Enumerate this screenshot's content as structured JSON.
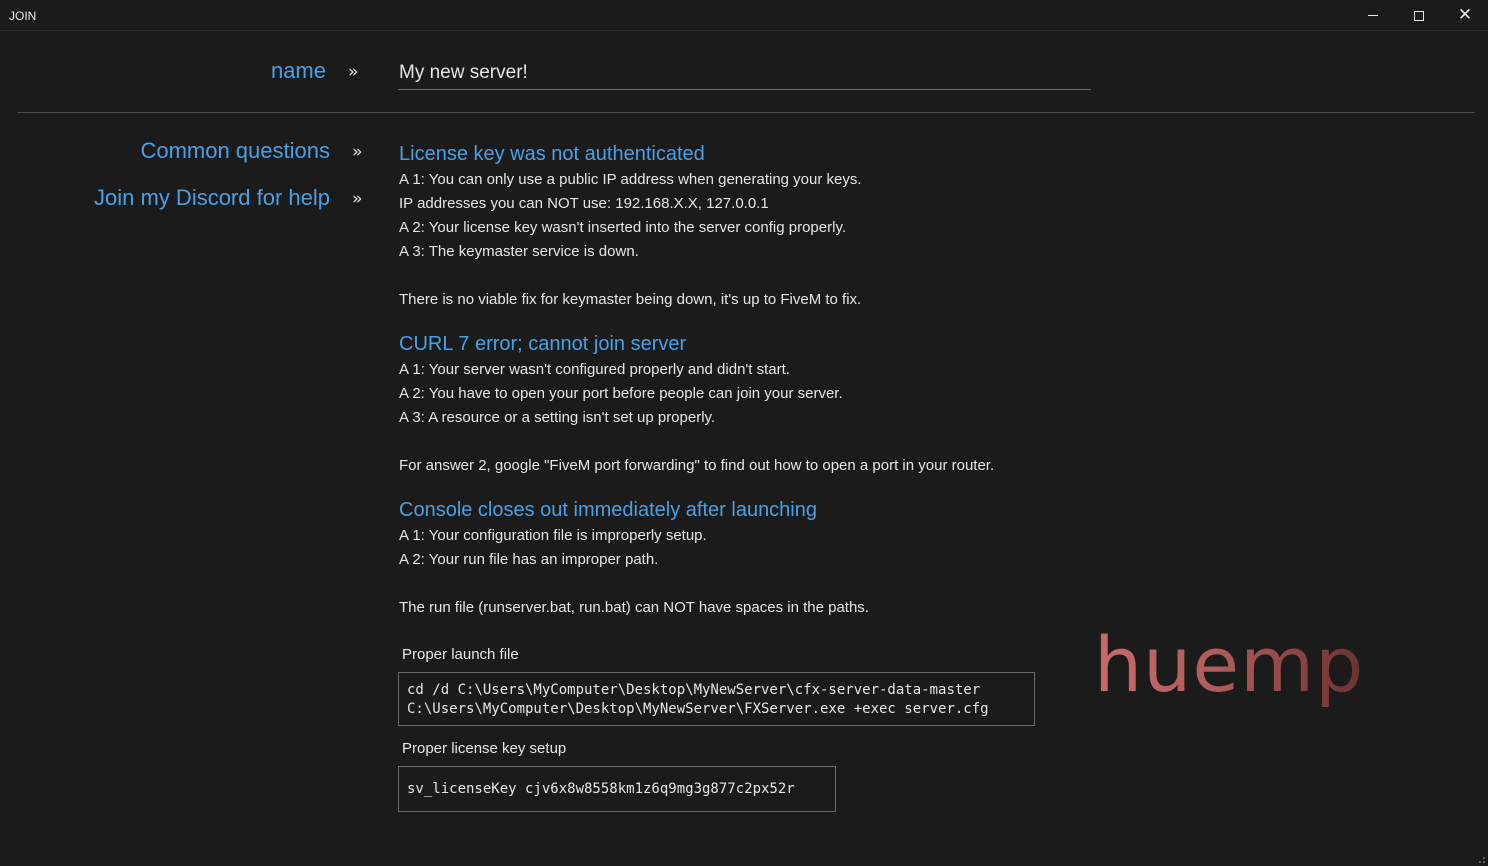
{
  "window": {
    "title": "JOIN",
    "minimize_glyph": "minimize-icon",
    "maximize_glyph": "maximize-icon",
    "close_glyph": "✕"
  },
  "name_row": {
    "label": "name",
    "chevron": "››",
    "value": "My new server!"
  },
  "nav": {
    "items": [
      {
        "label": "Common questions",
        "chevron": "››"
      },
      {
        "label": "Join my Discord for help",
        "chevron": "››"
      }
    ]
  },
  "faq": [
    {
      "title": "License key was not authenticated",
      "lines": [
        "A 1: You can only use a public IP address when generating your keys.",
        "IP addresses you can NOT use: 192.168.X.X, 127.0.0.1",
        "A 2: Your license key wasn't inserted into the server config properly.",
        "A 3: The keymaster service is down."
      ],
      "note": "There is no viable fix for keymaster being down, it's up to FiveM to fix."
    },
    {
      "title": "CURL 7 error; cannot join server",
      "lines": [
        "A 1: Your server wasn't configured properly and didn't start.",
        "A 2: You have to open your port before people can join your server.",
        "A 3: A resource or a setting isn't set up properly."
      ],
      "note": "For answer 2, google \"FiveM port forwarding\" to find out how to open a port in your router."
    },
    {
      "title": "Console closes out immediately after launching",
      "lines": [
        "A 1: Your configuration file is improperly setup.",
        "A 2: Your run file has an improper path."
      ],
      "note": "The run file (runserver.bat, run.bat) can NOT have spaces in the paths."
    }
  ],
  "launch_file": {
    "label": "Proper launch file",
    "line1": "cd /d C:\\Users\\MyComputer\\Desktop\\MyNewServer\\cfx-server-data-master",
    "line2": "C:\\Users\\MyComputer\\Desktop\\MyNewServer\\FXServer.exe +exec server.cfg"
  },
  "license_setup": {
    "label": "Proper license key setup",
    "code": "sv_licenseKey cjv6x8w8558km1z6q9mg3g877c2px52r"
  },
  "logo": {
    "text": "huemp",
    "color_start": "#c86a6a",
    "color_end": "#6a3232"
  },
  "colors": {
    "accent": "#4aa0e6",
    "background": "#1b1b1b",
    "text": "#e6e6e6"
  }
}
